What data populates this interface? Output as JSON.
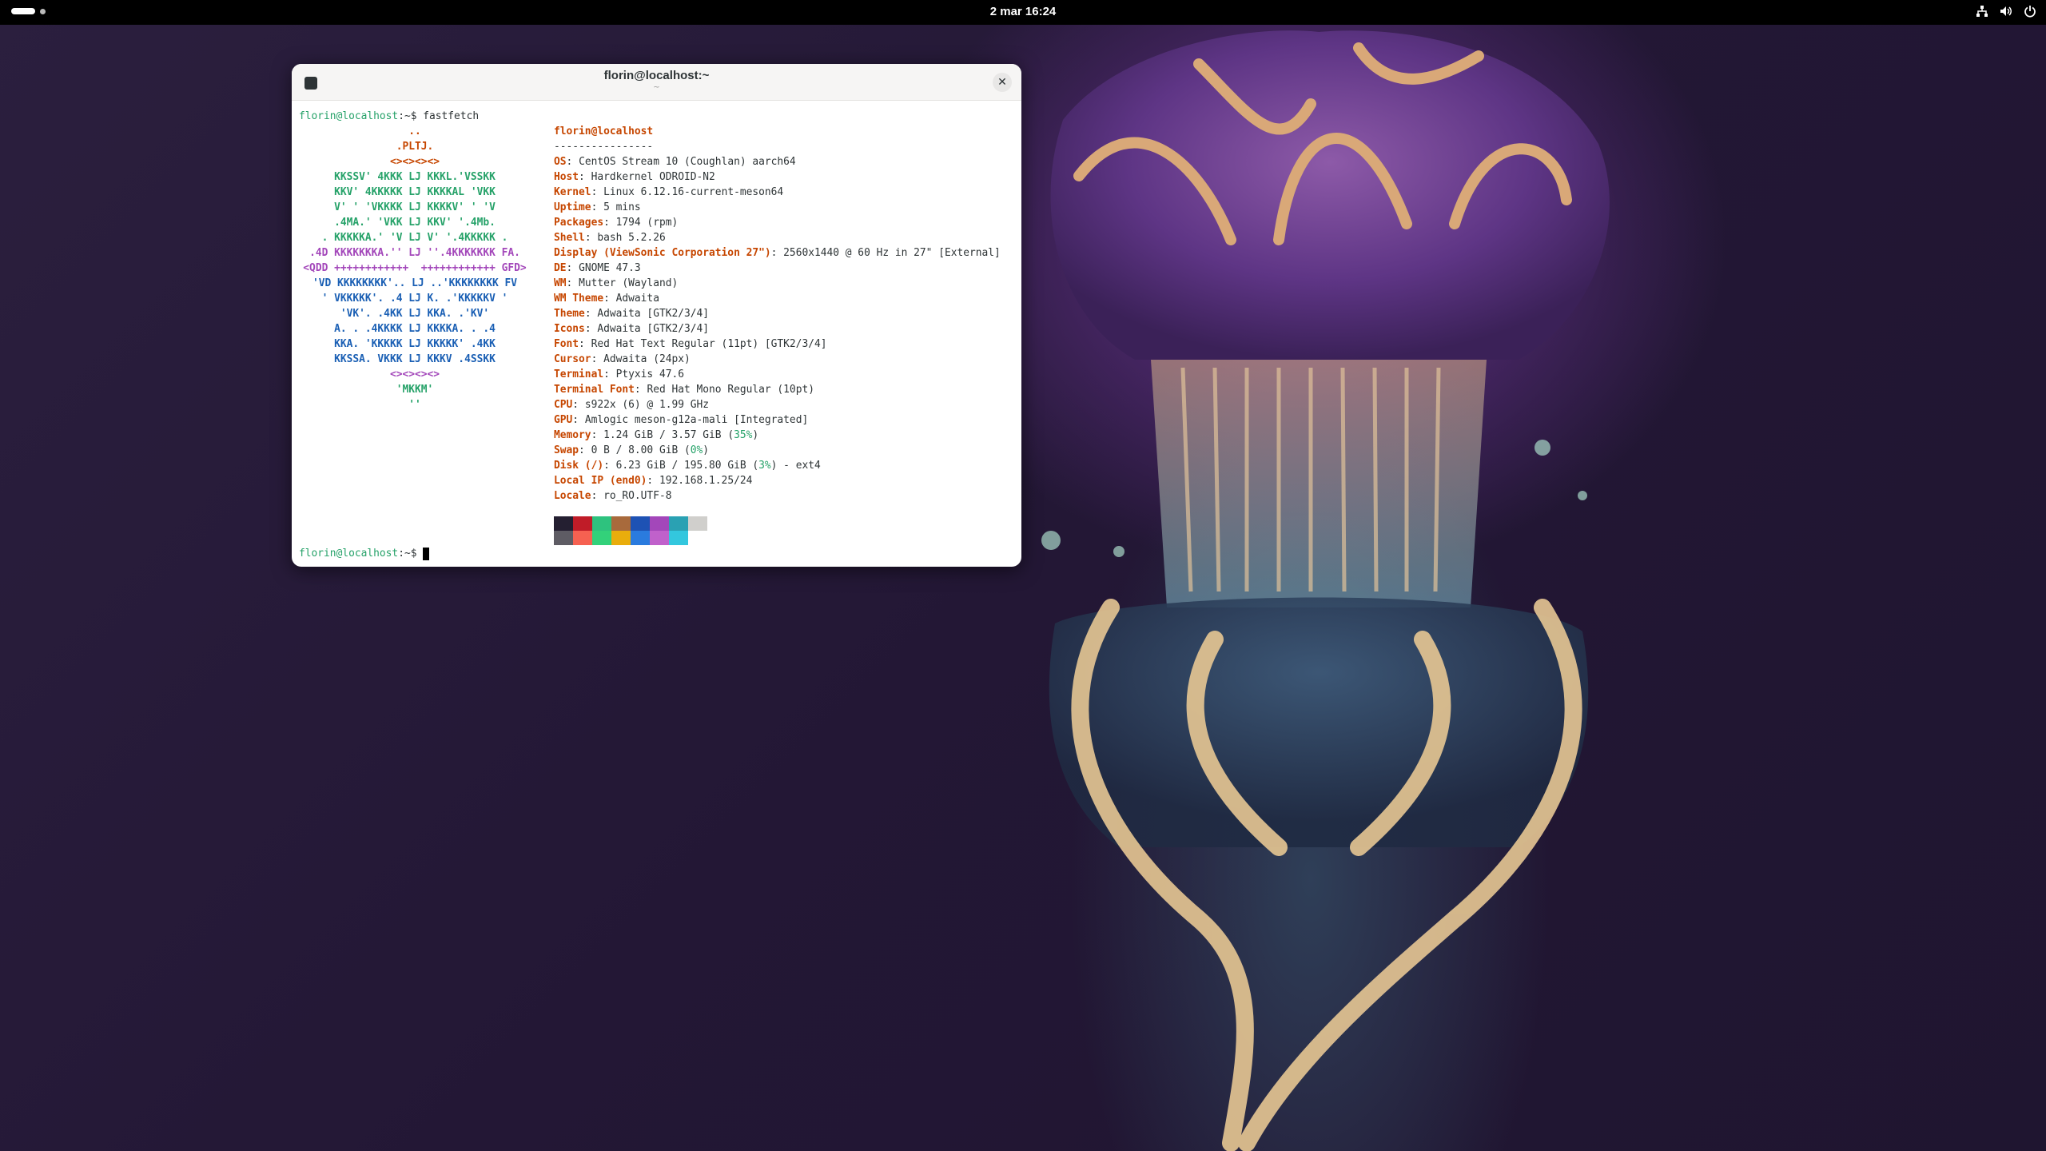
{
  "topbar": {
    "clock": "2 mar  16:24",
    "tray_icons": [
      "network-icon",
      "volume-icon",
      "power-icon"
    ]
  },
  "terminal": {
    "title": "florin@localhost:~",
    "subtitle": "~",
    "close_glyph": "✕",
    "prompt_user": "florin@localhost",
    "prompt_path": ":~$",
    "command": "fastfetch",
    "logo_lines": [
      "..",
      ".PLTJ.",
      "<><><><>",
      "KKSSV' 4KKK LJ KKKL.'VSSKK",
      "KKV' 4KKKKK LJ KKKKAL 'VKK",
      "V' ' 'VKKKK LJ KKKKV' ' 'V",
      ".4MA.' 'VKK LJ KKV' '.4Mb.",
      ". KKKKKA.' 'V LJ V' '.4KKKKK .",
      ".4D KKKKKKKA.'' LJ ''.4KKKKKKK FA.",
      "<QDD ++++++++++++  ++++++++++++ GFD>",
      "'VD KKKKKKKK'.. LJ ..'KKKKKKKK FV",
      "' VKKKKK'. .4 LJ K. .'KKKKKV '",
      "'VK'. .4KK LJ KKA. .'KV'",
      "A. . .4KKKK LJ KKKKA. . .4",
      "KKA. 'KKKKK LJ KKKKK' .4KK",
      "KKSSA. VKKK LJ KKKV .4SSKK",
      "<><><><>",
      "'MKKM'",
      "''"
    ],
    "user_host": "florin@localhost",
    "separator": "----------------",
    "info": [
      {
        "key": "OS",
        "value": "CentOS Stream 10 (Coughlan) aarch64"
      },
      {
        "key": "Host",
        "value": "Hardkernel ODROID-N2"
      },
      {
        "key": "Kernel",
        "value": "Linux 6.12.16-current-meson64"
      },
      {
        "key": "Uptime",
        "value": "5 mins"
      },
      {
        "key": "Packages",
        "value": "1794 (rpm)"
      },
      {
        "key": "Shell",
        "value": "bash 5.2.26"
      },
      {
        "key": "Display (ViewSonic Corporation 27\")",
        "value": "2560x1440 @ 60 Hz in 27\" [External]"
      },
      {
        "key": "DE",
        "value": "GNOME 47.3"
      },
      {
        "key": "WM",
        "value": "Mutter (Wayland)"
      },
      {
        "key": "WM Theme",
        "value": "Adwaita"
      },
      {
        "key": "Theme",
        "value": "Adwaita [GTK2/3/4]"
      },
      {
        "key": "Icons",
        "value": "Adwaita [GTK2/3/4]"
      },
      {
        "key": "Font",
        "value": "Red Hat Text Regular (11pt) [GTK2/3/4]"
      },
      {
        "key": "Cursor",
        "value": "Adwaita (24px)"
      },
      {
        "key": "Terminal",
        "value": "Ptyxis 47.6"
      },
      {
        "key": "Terminal Font",
        "value": "Red Hat Mono Regular (10pt)"
      },
      {
        "key": "CPU",
        "value": "s922x (6) @ 1.99 GHz"
      },
      {
        "key": "GPU",
        "value": "Amlogic meson-g12a-mali [Integrated]"
      },
      {
        "key": "Memory",
        "value_pre": "1.24 GiB / 3.57 GiB (",
        "pct": "35%",
        "value_post": ")"
      },
      {
        "key": "Swap",
        "value_pre": "0 B / 8.00 GiB (",
        "pct": "0%",
        "value_post": ")"
      },
      {
        "key": "Disk (/)",
        "value_pre": "6.23 GiB / 195.80 GiB (",
        "pct": "3%",
        "value_post": ") - ext4"
      },
      {
        "key": "Local IP (end0)",
        "value": "192.168.1.25/24"
      },
      {
        "key": "Locale",
        "value": "ro_RO.UTF-8"
      }
    ],
    "palette_top": [
      "#241f31",
      "#c01c28",
      "#2ec27e",
      "#a86a3c",
      "#1e52b4",
      "#a347ba",
      "#2aa1b3",
      "#d0cfcc"
    ],
    "palette_bottom": [
      "#5e5c64",
      "#f66151",
      "#33d17a",
      "#e9ad0c",
      "#2a7bde",
      "#c061cb",
      "#33c7de",
      "#ffffff"
    ]
  }
}
